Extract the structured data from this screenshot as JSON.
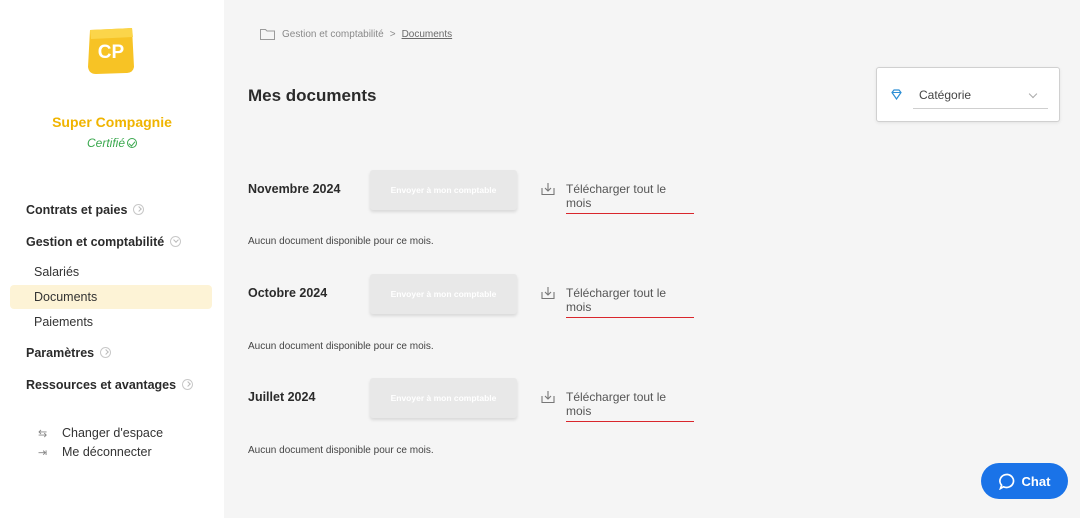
{
  "sidebar": {
    "logo_text": "CP",
    "company_name": "Super Compagnie",
    "certified_label": "Certifié",
    "sections": [
      {
        "label": "Contrats et paies"
      },
      {
        "label": "Gestion et comptabilité"
      },
      {
        "label": "Paramètres"
      },
      {
        "label": "Ressources et avantages"
      }
    ],
    "sub_items": [
      {
        "label": "Salariés"
      },
      {
        "label": "Documents"
      },
      {
        "label": "Paiements"
      }
    ],
    "footer": [
      {
        "label": "Changer d'espace",
        "icon": "swap-icon"
      },
      {
        "label": "Me déconnecter",
        "icon": "logout-icon"
      }
    ]
  },
  "breadcrumb": {
    "parent": "Gestion et comptabilité",
    "separator": ">",
    "current": "Documents"
  },
  "page": {
    "title": "Mes documents"
  },
  "filter": {
    "category_label": "Catégorie"
  },
  "months": [
    {
      "label": "Novembre 2024",
      "send_label": "Envoyer à mon comptable",
      "download_label": "Télécharger tout le mois",
      "empty_text": "Aucun document disponible pour ce mois."
    },
    {
      "label": "Octobre 2024",
      "send_label": "Envoyer à mon comptable",
      "download_label": "Télécharger tout le mois",
      "empty_text": "Aucun document disponible pour ce mois."
    },
    {
      "label": "Juillet 2024",
      "send_label": "Envoyer à mon comptable",
      "download_label": "Télécharger tout le mois",
      "empty_text": "Aucun document disponible pour ce mois."
    }
  ],
  "chat": {
    "label": "Chat"
  },
  "colors": {
    "brand_yellow": "#f0b400",
    "certified_green": "#3aa84e",
    "chat_blue": "#1a73e8",
    "underline_red": "#d9262c"
  }
}
